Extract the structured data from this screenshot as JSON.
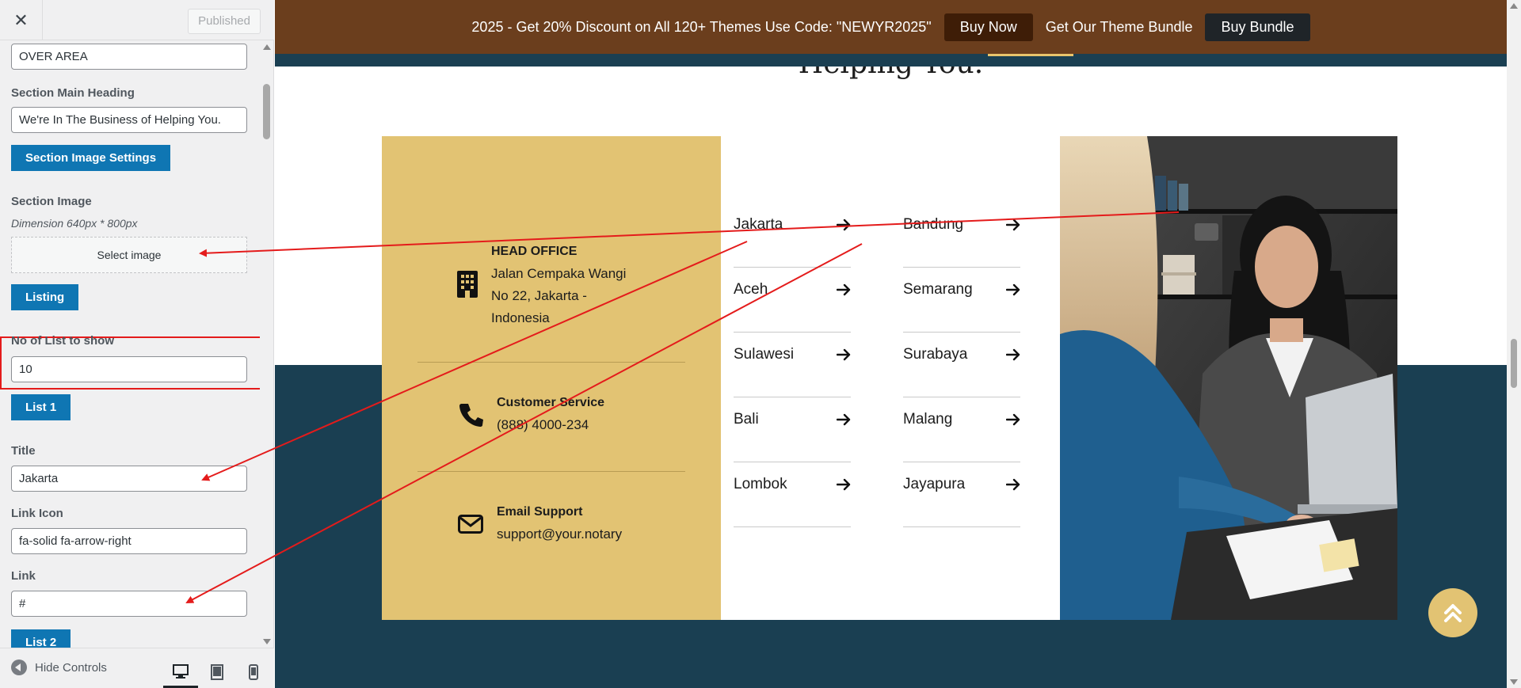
{
  "sidebar": {
    "close_glyph": "✕",
    "published_label": "Published",
    "over_area_value": "OVER AREA",
    "section_main_heading_label": "Section Main Heading",
    "section_main_heading_value": "We're In The Business of Helping You.",
    "section_image_settings_label": "Section Image Settings",
    "section_image_label": "Section Image",
    "dimension_note": "Dimension 640px * 800px",
    "select_image_label": "Select image",
    "listing_label": "Listing",
    "list_count_label": "No of List to show",
    "list_count_value": "10",
    "list1_label": "List 1",
    "title_label": "Title",
    "title_value": "Jakarta",
    "link_icon_label": "Link Icon",
    "link_icon_value": "fa-solid fa-arrow-right",
    "link_label": "Link",
    "link_value": "#",
    "list2_label": "List 2",
    "hide_controls_label": "Hide Controls",
    "devices": [
      "desktop-icon",
      "tablet-icon",
      "mobile-icon"
    ]
  },
  "promo": {
    "text": "2025 - Get 20% Discount on All 120+ Themes Use Code: \"NEWYR2025\"",
    "buy_now_label": "Buy Now",
    "bundle_text": "Get Our Theme Bundle",
    "buy_bundle_label": "Buy Bundle"
  },
  "section": {
    "heading": "Helping You."
  },
  "contacts": [
    {
      "icon": "building-icon",
      "title": "HEAD OFFICE",
      "lines": [
        "Jalan Cempaka Wangi",
        "No 22, Jakarta -",
        "Indonesia"
      ]
    },
    {
      "icon": "phone-icon",
      "title": "Customer Service",
      "lines": [
        "(888) 4000-234"
      ]
    },
    {
      "icon": "envelope-icon",
      "title": "Email Support",
      "lines": [
        "support@your.notary"
      ]
    }
  ],
  "cities_left": [
    "Jakarta",
    "Aceh",
    "Sulawesi",
    "Bali",
    "Lombok"
  ],
  "cities_right": [
    "Bandung",
    "Semarang",
    "Surabaya",
    "Malang",
    "Jayapura"
  ],
  "colors": {
    "promo_bg": "#6b3e1d",
    "gold": "#e2c373",
    "dark_teal": "#1a3f52",
    "wp_blue": "#0f76b3",
    "annotation_red": "#e41b1b"
  }
}
